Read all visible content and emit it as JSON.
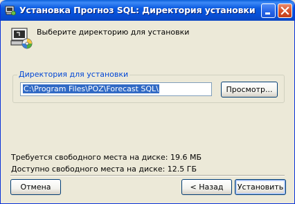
{
  "window": {
    "title": "Установка Прогноз SQL: Директория установки",
    "accent_color": "#0a5ae0"
  },
  "header": {
    "text": "Выберите директорию для установки"
  },
  "directory_group": {
    "label": "Директория для установки",
    "path_value": "C:\\Program Files\\POZ\\Forecast SQL\\",
    "browse_label": "Просмотр..."
  },
  "space": {
    "required": "Требуется свободного места на диске: 19.6 МБ",
    "available": "Доступно свободного места на диске: 12.5 ГБ"
  },
  "footer": {
    "cancel_label": "Отмена",
    "back_label": "< Назад",
    "install_label": "Установить"
  },
  "icons": {
    "title": "installer-icon",
    "header": "installer-disk-icon",
    "minimize": "minimize-icon",
    "close": "close-icon"
  }
}
